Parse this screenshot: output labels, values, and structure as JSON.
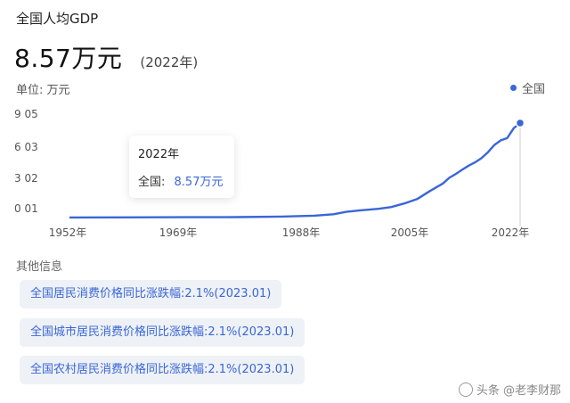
{
  "header": {
    "title": "全国人均GDP",
    "value": "8.57万元",
    "year_note": "(2022年)",
    "unit_label": "单位:  万元",
    "legend_label": "全国"
  },
  "colors": {
    "accent": "#3a66d6",
    "card_bg": "#eef1f6"
  },
  "chart_data": {
    "type": "line",
    "title": "",
    "xlabel": "",
    "ylabel": "",
    "y_ticks": [
      "9 05",
      "6 03",
      "3 02",
      "0 01"
    ],
    "x_ticks": [
      "1952年",
      "1969年",
      "1988年",
      "2005年",
      "2022年"
    ],
    "xlim": [
      1952,
      2022
    ],
    "ylim": [
      0,
      9.05
    ],
    "series": [
      {
        "name": "全国",
        "x": [
          1952,
          1960,
          1970,
          1978,
          1985,
          1988,
          1990,
          1993,
          1995,
          1997,
          2000,
          2002,
          2004,
          2006,
          2008,
          2010,
          2011,
          2012,
          2013,
          2014,
          2015,
          2016,
          2017,
          2018,
          2019,
          2020,
          2021,
          2022
        ],
        "y": [
          0.012,
          0.02,
          0.03,
          0.04,
          0.09,
          0.14,
          0.17,
          0.3,
          0.52,
          0.64,
          0.79,
          0.95,
          1.28,
          1.67,
          2.41,
          3.09,
          3.6,
          3.95,
          4.33,
          4.7,
          5.0,
          5.38,
          5.92,
          6.58,
          7.0,
          7.2,
          8.1,
          8.57
        ]
      }
    ],
    "highlight_year": 2022,
    "grid": false
  },
  "tooltip": {
    "year": "2022年",
    "series_label": "全国:",
    "value": "8.57万元"
  },
  "other_info": {
    "title": "其他信息",
    "items": [
      "全国居民消费价格同比涨跌幅:2.1%(2023.01)",
      "全国城市居民消费价格同比涨跌幅:2.1%(2023.01)",
      "全国农村居民消费价格同比涨跌幅:2.1%(2023.01)"
    ]
  },
  "watermark": "头条 @老李财那"
}
